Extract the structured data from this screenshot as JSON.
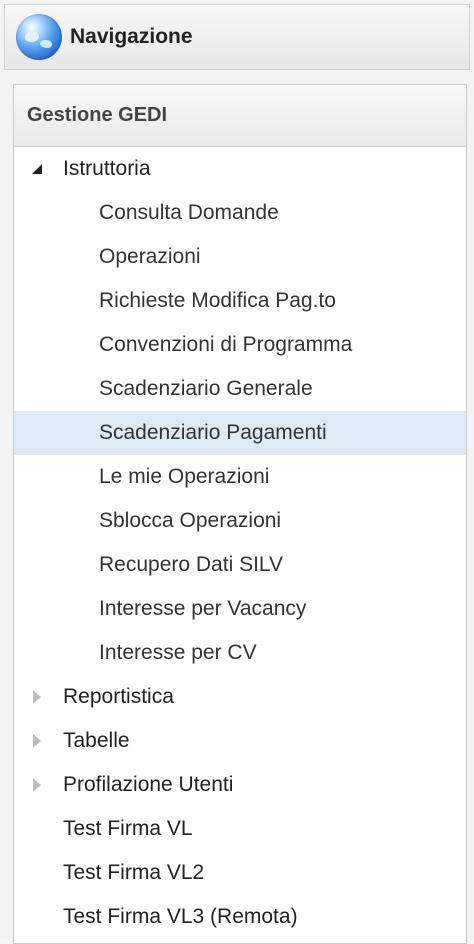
{
  "header": {
    "title": "Navigazione",
    "icon": "globe-icon"
  },
  "menu": {
    "section_title": "Gestione GEDI",
    "items": [
      {
        "label": "Istruttoria",
        "level": 0,
        "toggle": "expanded"
      },
      {
        "label": "Consulta Domande",
        "level": 1
      },
      {
        "label": "Operazioni",
        "level": 1
      },
      {
        "label": "Richieste Modifica Pag.to",
        "level": 1
      },
      {
        "label": "Convenzioni di Programma",
        "level": 1
      },
      {
        "label": "Scadenziario Generale",
        "level": 1
      },
      {
        "label": "Scadenziario Pagamenti",
        "level": 1,
        "selected": true
      },
      {
        "label": "Le mie Operazioni",
        "level": 1
      },
      {
        "label": "Sblocca Operazioni",
        "level": 1
      },
      {
        "label": "Recupero Dati SILV",
        "level": 1
      },
      {
        "label": "Interesse per Vacancy",
        "level": 1
      },
      {
        "label": "Interesse per CV",
        "level": 1
      },
      {
        "label": "Reportistica",
        "level": 0,
        "toggle": "collapsed"
      },
      {
        "label": "Tabelle",
        "level": 0,
        "toggle": "collapsed"
      },
      {
        "label": "Profilazione Utenti",
        "level": 0,
        "toggle": "collapsed"
      },
      {
        "label": "Test Firma VL",
        "level": 0
      },
      {
        "label": "Test Firma VL2",
        "level": 0
      },
      {
        "label": "Test Firma VL3 (Remota)",
        "level": 0
      }
    ]
  },
  "colors": {
    "selected_row": "#dde9f3",
    "expanded_arrow": "#222222",
    "collapsed_arrow": "#bdbdbd"
  }
}
